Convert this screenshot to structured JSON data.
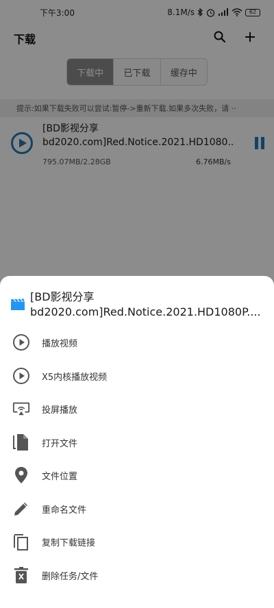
{
  "status_bar": {
    "time": "下午3:00",
    "network_speed": "8.1M/s",
    "battery": "62"
  },
  "app_bar": {
    "title": "下载",
    "icons": [
      "search-icon",
      "add-icon"
    ]
  },
  "tabs": [
    {
      "label": "下载中",
      "active": true
    },
    {
      "label": "已下载",
      "active": false
    },
    {
      "label": "缓存中",
      "active": false
    }
  ],
  "hint": "提示:如果下载失败可以尝试:暂停->重新下载.如果多次失败，请 ··",
  "download": {
    "name_line1": "[BD影视分享",
    "name_line2": "bd2020.com]Red.Notice.2021.HD1080...",
    "size": "795.07MB/2.28GB",
    "speed": "6.76MB/s"
  },
  "sheet": {
    "title_line1": "[BD影视分享",
    "title_line2": "bd2020.com]Red.Notice.2021.HD1080P....",
    "menu": [
      {
        "label": "播放视频",
        "icon": "play-circle-icon"
      },
      {
        "label": "X5内核播放视频",
        "icon": "play-circle-icon"
      },
      {
        "label": "投屏播放",
        "icon": "cast-icon"
      },
      {
        "label": "打开文件",
        "icon": "file-icon"
      },
      {
        "label": "文件位置",
        "icon": "location-pin-icon"
      },
      {
        "label": "重命名文件",
        "icon": "pencil-icon"
      },
      {
        "label": "复制下载链接",
        "icon": "copy-icon"
      },
      {
        "label": "删除任务/文件",
        "icon": "trash-icon"
      }
    ]
  },
  "colors": {
    "accent": "#1e7ab8",
    "scrim": "rgba(0,0,0,0.45)",
    "tab_active": "#8a8a8a"
  }
}
